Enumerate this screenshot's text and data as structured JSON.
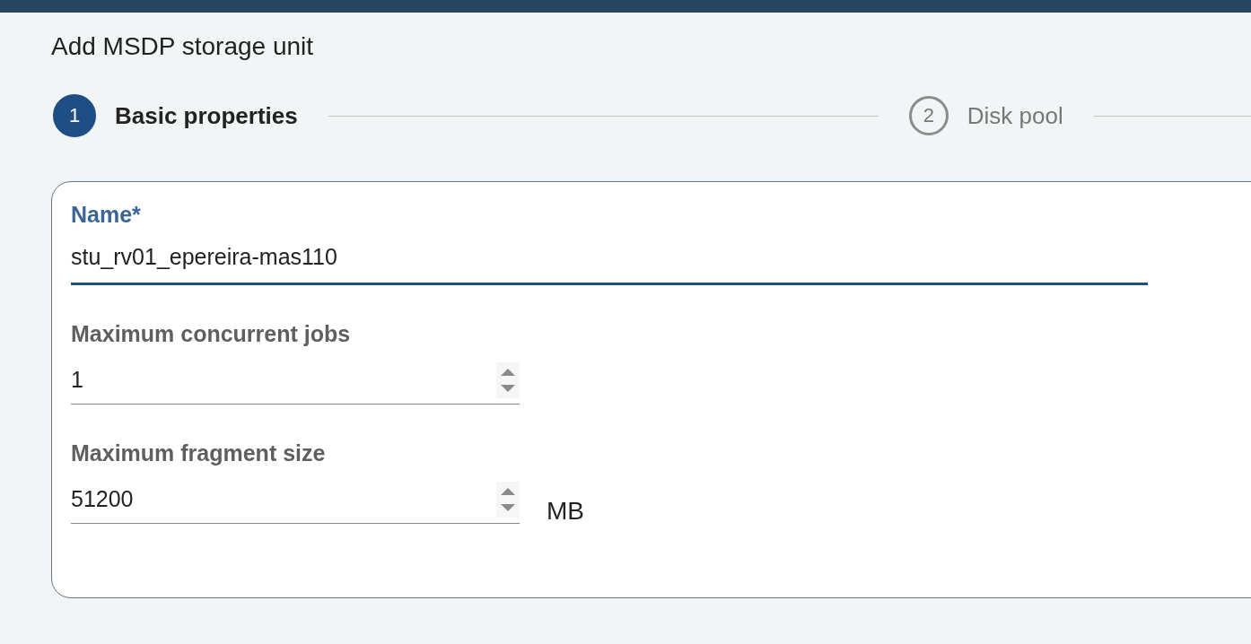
{
  "title": "Add MSDP storage unit",
  "steps": [
    {
      "number": "1",
      "label": "Basic properties",
      "selected": true
    },
    {
      "number": "2",
      "label": "Disk pool",
      "selected": false
    }
  ],
  "fields": [
    {
      "kind": "text",
      "label": "Name*",
      "value": "stu_rv01_epereira-mas110",
      "focused": true
    },
    {
      "kind": "number",
      "label": "Maximum concurrent jobs",
      "value": "1",
      "focused": false
    },
    {
      "kind": "number",
      "label": "Maximum fragment size",
      "value": "51200",
      "unit": "MB",
      "focused": false
    }
  ]
}
